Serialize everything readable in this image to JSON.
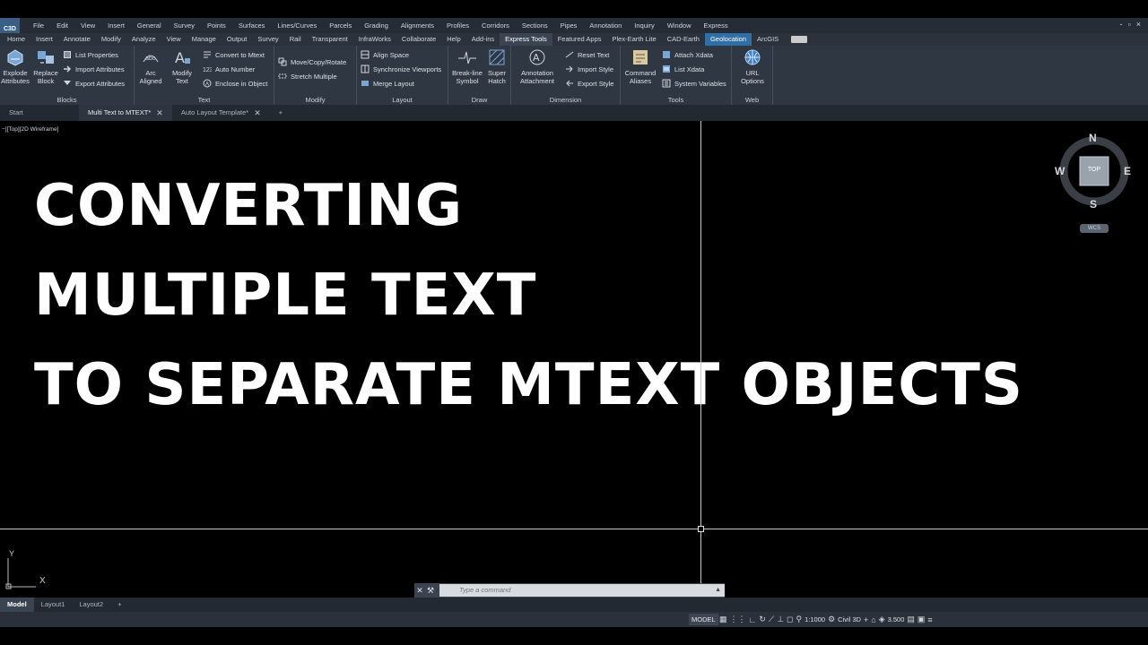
{
  "menubar": {
    "app_logo": "C3D",
    "items": [
      "File",
      "Edit",
      "View",
      "Insert",
      "General",
      "Survey",
      "Points",
      "Surfaces",
      "Lines/Curves",
      "Parcels",
      "Grading",
      "Alignments",
      "Profiles",
      "Corridors",
      "Sections",
      "Pipes",
      "Annotation",
      "Inquiry",
      "Window",
      "Express"
    ],
    "window_controls": [
      "-",
      "▫",
      "×"
    ]
  },
  "ribbon_tabs": [
    "Home",
    "Insert",
    "Annotate",
    "Modify",
    "Analyze",
    "View",
    "Manage",
    "Output",
    "Survey",
    "Rail",
    "Transparent",
    "InfraWorks",
    "Collaborate",
    "Help",
    "Add-ins",
    "Express Tools",
    "Featured Apps",
    "Plex-Earth Lite",
    "CAD-Earth",
    "Geolocation",
    "ArcGIS"
  ],
  "ribbon_active_tab": "Express Tools",
  "ribbon": {
    "blocks": {
      "title": "Blocks",
      "explode": "Explode Attributes",
      "replace": "Replace Block",
      "list_properties": "List Properties",
      "import_attributes": "Import Attributes",
      "export_attributes": "Export Attributes"
    },
    "text": {
      "title": "Text",
      "arc_aligned": "Arc Aligned",
      "modify_text": "Modify Text",
      "convert_to_mtext": "Convert to Mtext",
      "auto_number": "Auto Number",
      "enclose_in_object": "Enclose in Object"
    },
    "modify": {
      "title": "Modify",
      "move_copy_rotate": "Move/Copy/Rotate",
      "stretch_multiple": "Stretch Multiple"
    },
    "layout": {
      "title": "Layout",
      "align_space": "Align Space",
      "synchronize_viewports": "Synchronize Viewports",
      "merge_layout": "Merge Layout"
    },
    "draw": {
      "title": "Draw",
      "break_line": "Break-line Symbol",
      "super_hatch": "Super Hatch"
    },
    "dimension": {
      "title": "Dimension",
      "annotation_attachment": "Annotation Attachment",
      "reset_text": "Reset Text",
      "import_style": "Import Style",
      "export_style": "Export Style"
    },
    "tools": {
      "title": "Tools",
      "command_aliases": "Command Aliases",
      "attach_xdata": "Attach Xdata",
      "list_xdata": "List Xdata",
      "system_variables": "System Variables"
    },
    "web": {
      "title": "Web",
      "url_options": "URL Options"
    }
  },
  "doc_tabs": [
    {
      "label": "Start"
    },
    {
      "label": "Multi Text to MTEXT*"
    },
    {
      "label": "Auto Layout Template*"
    }
  ],
  "viewport": {
    "view_label": "−][Top][2D Wireframe]",
    "headline": [
      "CONVERTING",
      "MULTIPLE TEXT",
      "TO SEPARATE MTEXT OBJECTS"
    ],
    "viewcube": {
      "n": "N",
      "s": "S",
      "e": "E",
      "w": "W",
      "top": "TOP",
      "wcs": "WCS"
    },
    "ucs": {
      "x": "X",
      "y": "Y"
    }
  },
  "command_line": {
    "placeholder": "Type a command"
  },
  "layout_tabs": [
    "Model",
    "Layout1",
    "Layout2"
  ],
  "statusbar": {
    "model": "MODEL",
    "scale": "1:1000",
    "workspace": "Civil 3D",
    "value": "3.500"
  }
}
